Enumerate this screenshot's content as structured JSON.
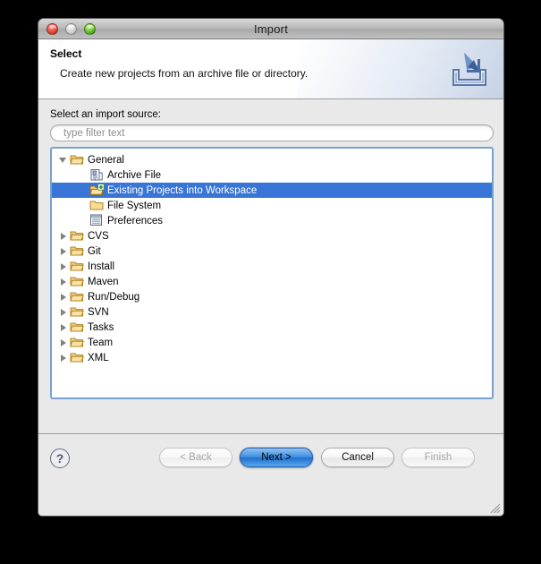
{
  "window": {
    "title": "Import",
    "controls": [
      {
        "name": "close-button",
        "color": "#e2483c"
      },
      {
        "name": "minimize-button",
        "color": "#cfcfcf"
      },
      {
        "name": "zoom-button",
        "color": "#5fbb2a"
      }
    ]
  },
  "header": {
    "title": "Select",
    "description": "Create new projects from an archive file or directory.",
    "icon": "import-banner-icon"
  },
  "main": {
    "source_label": "Select an import source:",
    "filter": {
      "value": "",
      "placeholder": "type filter text"
    },
    "tree": [
      {
        "label": "General",
        "indent": 0,
        "twisty": "expanded",
        "icon": "open-folder-icon",
        "selected": false
      },
      {
        "label": "Archive File",
        "indent": 1,
        "twisty": "none",
        "icon": "archive-file-icon",
        "selected": false
      },
      {
        "label": "Existing Projects into Workspace",
        "indent": 1,
        "twisty": "none",
        "icon": "existing-projects-icon",
        "selected": true
      },
      {
        "label": "File System",
        "indent": 1,
        "twisty": "none",
        "icon": "file-system-folder-icon",
        "selected": false
      },
      {
        "label": "Preferences",
        "indent": 1,
        "twisty": "none",
        "icon": "preferences-icon",
        "selected": false
      },
      {
        "label": "CVS",
        "indent": 0,
        "twisty": "collapsed",
        "icon": "open-folder-icon",
        "selected": false
      },
      {
        "label": "Git",
        "indent": 0,
        "twisty": "collapsed",
        "icon": "open-folder-icon",
        "selected": false
      },
      {
        "label": "Install",
        "indent": 0,
        "twisty": "collapsed",
        "icon": "open-folder-icon",
        "selected": false
      },
      {
        "label": "Maven",
        "indent": 0,
        "twisty": "collapsed",
        "icon": "open-folder-icon",
        "selected": false
      },
      {
        "label": "Run/Debug",
        "indent": 0,
        "twisty": "collapsed",
        "icon": "open-folder-icon",
        "selected": false
      },
      {
        "label": "SVN",
        "indent": 0,
        "twisty": "collapsed",
        "icon": "open-folder-icon",
        "selected": false
      },
      {
        "label": "Tasks",
        "indent": 0,
        "twisty": "collapsed",
        "icon": "open-folder-icon",
        "selected": false
      },
      {
        "label": "Team",
        "indent": 0,
        "twisty": "collapsed",
        "icon": "open-folder-icon",
        "selected": false
      },
      {
        "label": "XML",
        "indent": 0,
        "twisty": "collapsed",
        "icon": "open-folder-icon",
        "selected": false
      }
    ],
    "selection_color": "#3875d7"
  },
  "footer": {
    "help_label": "?",
    "buttons": [
      {
        "id": "back",
        "label": "< Back",
        "state": "disabled"
      },
      {
        "id": "next",
        "label": "Next >",
        "state": "default"
      },
      {
        "id": "cancel",
        "label": "Cancel",
        "state": "normal"
      },
      {
        "id": "finish",
        "label": "Finish",
        "state": "disabled"
      }
    ]
  }
}
